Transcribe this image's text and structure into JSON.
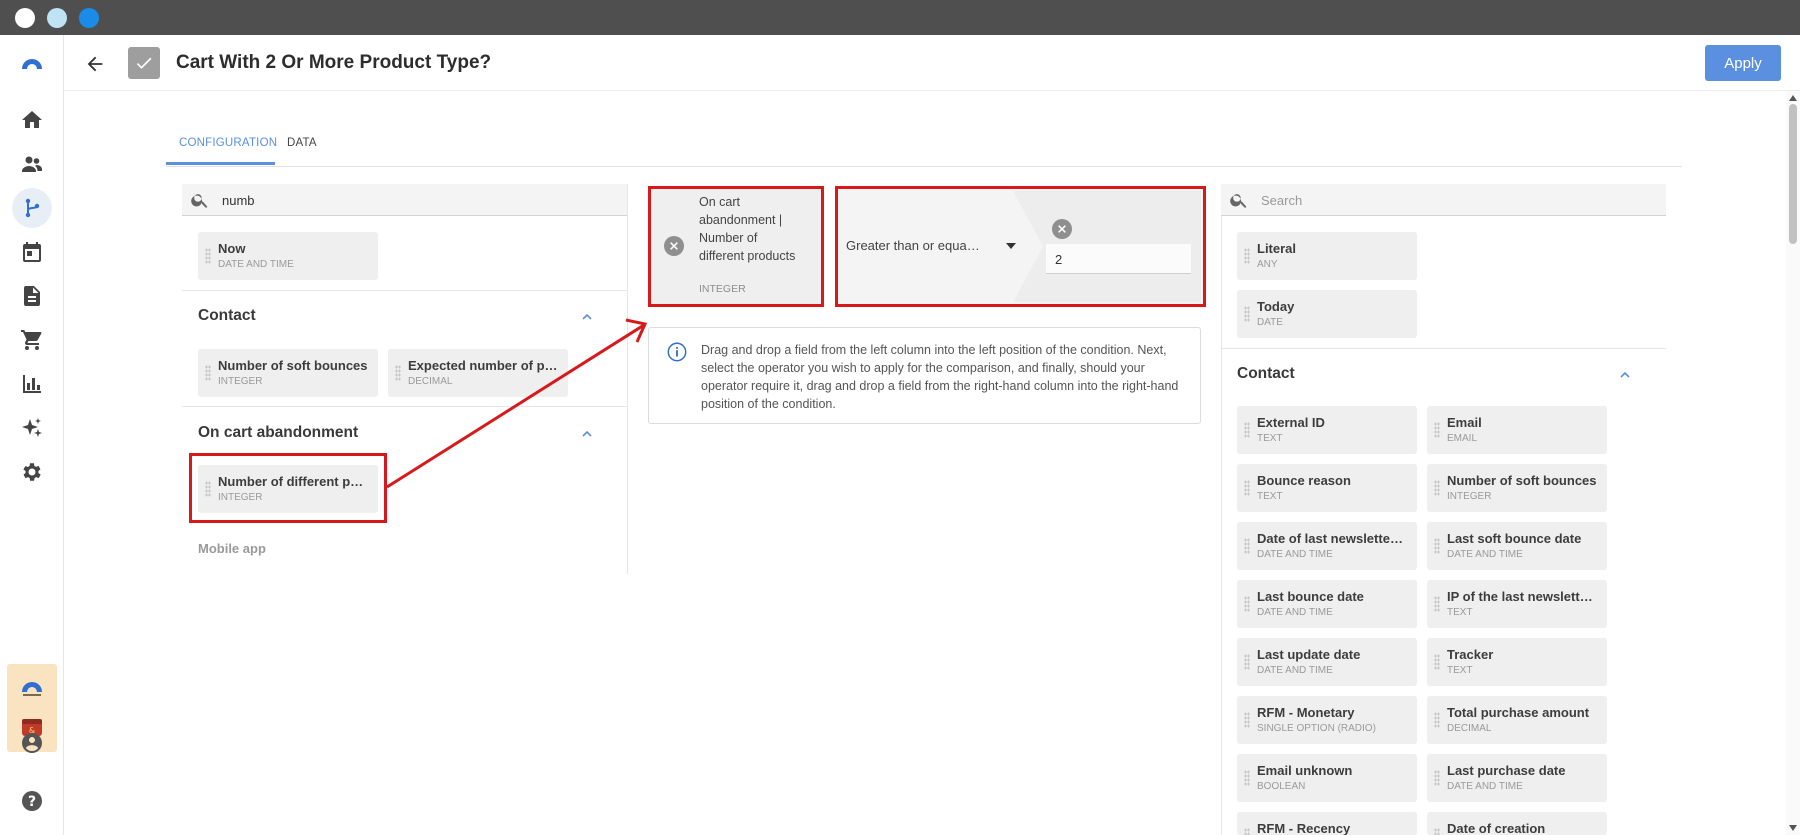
{
  "window": {
    "controls": [
      {
        "name": "close",
        "color": "#ffffff"
      },
      {
        "name": "minimize",
        "color": "#bde3f5"
      },
      {
        "name": "maximize",
        "color": "#1a8ce8"
      }
    ]
  },
  "nav": {
    "items": [
      "logo-icon",
      "home-icon",
      "contacts-icon",
      "scenarios-icon",
      "calendar-icon",
      "document-icon",
      "cart-icon",
      "chart-icon",
      "sparkle-icon",
      "gear-icon"
    ],
    "active": "scenarios-icon",
    "bottom": [
      "brand-logo-icon",
      "brand-app-icon",
      "account-icon",
      "help-icon"
    ]
  },
  "header": {
    "title": "Cart With 2 Or More Product Type?",
    "apply_label": "Apply"
  },
  "tabs": [
    {
      "label": "CONFIGURATION",
      "active": true
    },
    {
      "label": "DATA",
      "active": false
    }
  ],
  "left": {
    "search_value": "numb",
    "top_card": {
      "name": "Now",
      "type": "DATE AND TIME"
    },
    "sections": [
      {
        "title": "Contact",
        "cards": [
          {
            "name": "Number of soft bounces",
            "type": "INTEGER"
          },
          {
            "name": "Expected number of p…",
            "type": "DECIMAL"
          }
        ]
      },
      {
        "title": "On cart abandonment",
        "cards": [
          {
            "name": "Number of different pr…",
            "type": "INTEGER"
          }
        ]
      }
    ],
    "more_section": "Mobile app"
  },
  "condition": {
    "left_field": {
      "name": "On cart abandonment | Number of different products",
      "type": "INTEGER"
    },
    "operator": "Greater than or equa…",
    "value": "2",
    "info": "Drag and drop a field from the left column into the left position of the condition. Next, select the operator you wish to apply for the comparison, and finally, should your operator require it, drag and drop a field from the right-hand column into the right-hand position of the condition."
  },
  "right": {
    "search_placeholder": "Search",
    "top_cards": [
      {
        "name": "Literal",
        "type": "ANY"
      },
      {
        "name": "Today",
        "type": "DATE"
      }
    ],
    "section_title": "Contact",
    "cards": [
      {
        "name": "External ID",
        "type": "TEXT"
      },
      {
        "name": "Email",
        "type": "EMAIL"
      },
      {
        "name": "Bounce reason",
        "type": "TEXT"
      },
      {
        "name": "Number of soft bounces",
        "type": "INTEGER"
      },
      {
        "name": "Date of last newsletter…",
        "type": "DATE AND TIME"
      },
      {
        "name": "Last soft bounce date",
        "type": "DATE AND TIME"
      },
      {
        "name": "Last bounce date",
        "type": "DATE AND TIME"
      },
      {
        "name": "IP of the last newslette…",
        "type": "TEXT"
      },
      {
        "name": "Last update date",
        "type": "DATE AND TIME"
      },
      {
        "name": "Tracker",
        "type": "TEXT"
      },
      {
        "name": "RFM - Monetary",
        "type": "SINGLE OPTION (RADIO)"
      },
      {
        "name": "Total purchase amount",
        "type": "DECIMAL"
      },
      {
        "name": "Email unknown",
        "type": "BOOLEAN"
      },
      {
        "name": "Last purchase date",
        "type": "DATE AND TIME"
      },
      {
        "name": "RFM - Recency",
        "type": ""
      },
      {
        "name": "Date of creation",
        "type": ""
      }
    ]
  },
  "colors": {
    "accent": "#5b8fe0",
    "highlight": "#d7191c",
    "brand": "#2f6fd1"
  }
}
